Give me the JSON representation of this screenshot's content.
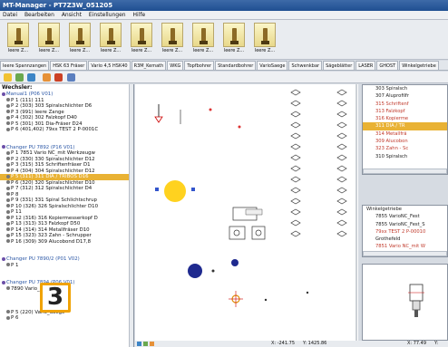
{
  "window": {
    "title": "MT-Manager - PT7Z3W_051205"
  },
  "menu": [
    "Datei",
    "Bearbeiten",
    "Ansicht",
    "Einstellungen",
    "Hilfe"
  ],
  "toolbar": {
    "buttons": [
      "leere Z...",
      "leere Z...",
      "leere Z...",
      "leere Z...",
      "leere Z...",
      "leere Z...",
      "leere Z...",
      "leere Z...",
      "leere Z..."
    ]
  },
  "tabs": [
    "leere Spannzangen",
    "HSK 63 Fräser",
    "Vario 4,5 HSK40",
    "R3M_Kemath",
    "WKG",
    "Topfbohrer",
    "Standardbohrer",
    "VarioSaege",
    "Schwenkbar",
    "Sägeblätter",
    "LASER",
    "GHOST",
    "Winkelgetriebe"
  ],
  "changer": {
    "title": "Wechsler:",
    "rows": [
      {
        "text": "Manual1 (P06 V01)",
        "kind": "blue"
      },
      {
        "text": "P 1 (111) 111",
        "kind": "normal"
      },
      {
        "text": "P 2 (303) 303 Spiralschlichter D6",
        "kind": "normal"
      },
      {
        "text": "P 3 (991) leere Zange",
        "kind": "normal"
      },
      {
        "text": "P 4 (302) 302 Falzkopf D40",
        "kind": "normal"
      },
      {
        "text": "P 5 (301) 301 Dia-Fräser D24",
        "kind": "normal"
      },
      {
        "text": "P 6 (401,402) 79xx TEST 2 P-0001C",
        "kind": "normal"
      },
      {
        "text": "",
        "kind": "normal"
      },
      {
        "text": "",
        "kind": "normal"
      },
      {
        "text": "Changer PU 7892 (P16 V01)",
        "kind": "blue"
      },
      {
        "text": "P 1 7851 Vario NC_mit Werkzeugw",
        "kind": "normal"
      },
      {
        "text": "P 2 (330) 330 Spiralschlichter D12",
        "kind": "normal"
      },
      {
        "text": "P 3 (315) 315 Schriftenfräser D1",
        "kind": "normal"
      },
      {
        "text": "P 4 (304) 304 Spiralschlichter D12",
        "kind": "normal"
      },
      {
        "text": "P 5 (311) 311 DIA / TRIBOS D16",
        "kind": "sel"
      },
      {
        "text": "P 6 (320) 320 Spiralschlichter D10",
        "kind": "normal"
      },
      {
        "text": "P 7 (312) 312 Spiralschlichter D4",
        "kind": "normal"
      },
      {
        "text": "P 8",
        "kind": "normal"
      },
      {
        "text": "P 9 (331) 331 Spiral Schlichtschrup",
        "kind": "normal"
      },
      {
        "text": "P 10 (326) 326 Spiralschlichter D10",
        "kind": "normal"
      },
      {
        "text": "P 11",
        "kind": "normal"
      },
      {
        "text": "P 12 (316) 316 Kopiermesserkopf D",
        "kind": "normal"
      },
      {
        "text": "P 13 (313) 313 Falzkopf D50",
        "kind": "normal"
      },
      {
        "text": "P 14 (314) 314 Metallfräser D10",
        "kind": "normal"
      },
      {
        "text": "P 15 (323) 323 Zahn - Schrupper",
        "kind": "normal"
      },
      {
        "text": "P 16 (309) 309 Alucobond D17,8",
        "kind": "normal"
      },
      {
        "text": "",
        "kind": "normal"
      },
      {
        "text": "",
        "kind": "normal"
      },
      {
        "text": "Changer PU 7890/2 (P01 V02)",
        "kind": "blue"
      },
      {
        "text": "P 1",
        "kind": "normal"
      },
      {
        "text": "",
        "kind": "normal"
      },
      {
        "text": "",
        "kind": "normal"
      },
      {
        "text": "Changer PU 7894 (P06 V01)",
        "kind": "blue"
      },
      {
        "text": "7890 Vario_HSK40",
        "kind": "normal"
      },
      {
        "text": "",
        "kind": "normal"
      },
      {
        "text": "",
        "kind": "normal"
      },
      {
        "text": "",
        "kind": "normal"
      },
      {
        "text": "P 5 (220) Vario_Saege",
        "kind": "normal"
      },
      {
        "text": "P 6",
        "kind": "normal"
      }
    ]
  },
  "right_top": {
    "rows": [
      {
        "text": "303 Spiralsch",
        "color": "#222"
      },
      {
        "text": "307 Aluprofilfr",
        "color": "#222"
      },
      {
        "text": "315 Schriftenf",
        "color": "#c0392b"
      },
      {
        "text": "313 Falzkopf",
        "color": "#c0392b"
      },
      {
        "text": "316 Kopierme",
        "color": "#c0392b"
      },
      {
        "text": "311 DIA / TR",
        "color": "#ffffff"
      },
      {
        "text": "314 Metallfrä",
        "color": "#c0392b"
      },
      {
        "text": "309 Alucobon",
        "color": "#c0392b"
      },
      {
        "text": "323 Zahn - Sc",
        "color": "#c0392b"
      },
      {
        "text": "310 Spiralsch",
        "color": "#222"
      }
    ]
  },
  "right_mid": {
    "rows": [
      {
        "text": "Winkelgetriebe",
        "color": "#222"
      },
      {
        "text": "7855 VarioNC_Fest",
        "color": "#222"
      },
      {
        "text": "7855 VarioNC_Fest_S",
        "color": "#222"
      },
      {
        "text": "79xx TEST 2 P-00010",
        "color": "#c0392b"
      },
      {
        "text": "Grothefeld",
        "color": "#222"
      },
      {
        "text": "7851 Vario NC_mit W",
        "color": "#c0392b"
      }
    ]
  },
  "status": {
    "coord1": "X: -241.75",
    "coord2": "Y: 1425.86",
    "coord3": "X: 77.49",
    "coord4": "Y:"
  },
  "badge": {
    "number": "3"
  }
}
